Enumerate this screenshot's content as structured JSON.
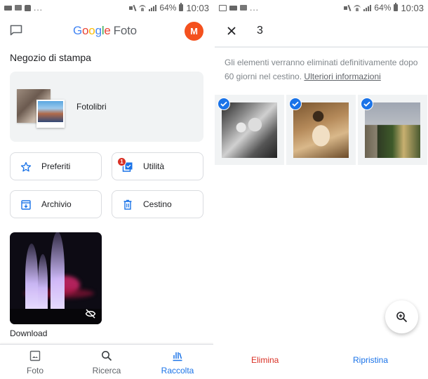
{
  "status_bar": {
    "battery": "64%",
    "time": "10:03",
    "overflow": "..."
  },
  "left_screen": {
    "app_title": {
      "letters": [
        "G",
        "o",
        "o",
        "g",
        "l",
        "e"
      ],
      "product": "Foto"
    },
    "avatar_initial": "M",
    "section_title": "Negozio di stampa",
    "print_card_label": "Fotolibri",
    "tiles": [
      {
        "label": "Preferiti",
        "icon": "star-outline-icon"
      },
      {
        "label": "Utilità",
        "icon": "utilities-icon",
        "badge": "1"
      },
      {
        "label": "Archivio",
        "icon": "archive-icon"
      },
      {
        "label": "Cestino",
        "icon": "trash-icon"
      }
    ],
    "album": {
      "label": "Download",
      "hidden_icon": "eye-off-icon"
    },
    "bottom_nav": [
      {
        "label": "Foto",
        "icon": "photo-icon",
        "active": false
      },
      {
        "label": "Ricerca",
        "icon": "search-icon",
        "active": false
      },
      {
        "label": "Raccolta",
        "icon": "library-icon",
        "active": true
      }
    ]
  },
  "right_screen": {
    "selection_count": "3",
    "info_text": "Gli elementi verranno eliminati definitivamente dopo 60 giorni nel cestino.",
    "info_link": "Ulteriori informazioni",
    "photos": [
      {
        "description": "gatto in bianco e nero",
        "selected": true
      },
      {
        "description": "gatto seppia",
        "selected": true
      },
      {
        "description": "paesaggio urbano",
        "selected": true
      }
    ],
    "actions": {
      "delete": "Elimina",
      "restore": "Ripristina"
    }
  },
  "colors": {
    "accent": "#1a73e8",
    "danger": "#d93025",
    "avatar": "#f4511e",
    "card_bg": "#f1f3f4"
  }
}
